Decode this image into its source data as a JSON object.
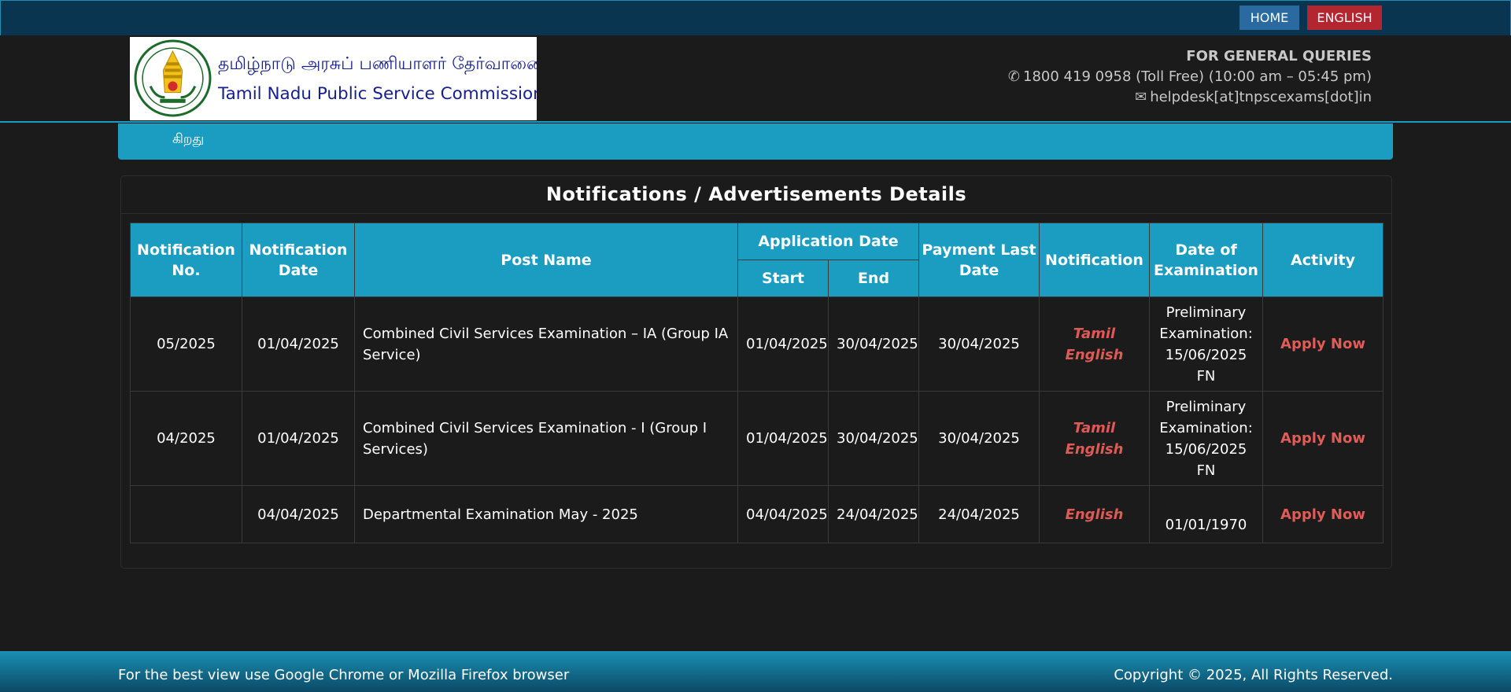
{
  "topbar": {
    "home_label": "HOME",
    "english_label": "ENGLISH"
  },
  "logo": {
    "tamil_name": "தமிழ்நாடு அரசுப் பணியாளர் தேர்வாணையம்",
    "english_name": "Tamil Nadu Public Service Commission"
  },
  "contact": {
    "heading": "FOR GENERAL QUERIES",
    "phone": "1800 419 0958 (Toll Free) (10:00 am – 05:45 pm)",
    "email": "helpdesk[at]tnpscexams[dot]in"
  },
  "nav": {
    "item": "கிறது"
  },
  "panel": {
    "title": "Notifications / Advertisements Details"
  },
  "table": {
    "headers": {
      "notification_no": "Notification No.",
      "notification_date": "Notification Date",
      "post_name": "Post Name",
      "application_date": "Application Date",
      "start": "Start",
      "end": "End",
      "payment_last_date": "Payment Last Date",
      "notification": "Notification",
      "date_of_examination": "Date of Examination",
      "activity": "Activity"
    },
    "rows": [
      {
        "no": "05/2025",
        "date": "01/04/2025",
        "post": "Combined Civil Services Examination – IA (Group IA Service)",
        "start": "01/04/2025",
        "end": "30/04/2025",
        "payment": "30/04/2025",
        "lang1": "Tamil",
        "lang2": "English",
        "exam": "Preliminary Examination: 15/06/2025 FN",
        "action": "Apply Now"
      },
      {
        "no": "04/2025",
        "date": "01/04/2025",
        "post": "Combined Civil Services Examination - I (Group I Services)",
        "start": "01/04/2025",
        "end": "30/04/2025",
        "payment": "30/04/2025",
        "lang1": "Tamil",
        "lang2": "English",
        "exam": "Preliminary Examination: 15/06/2025 FN",
        "action": "Apply Now"
      },
      {
        "no": "",
        "date": "04/04/2025",
        "post": "Departmental Examination May - 2025",
        "start": "04/04/2025",
        "end": "24/04/2025",
        "payment": "24/04/2025",
        "lang1": "English",
        "exam": "01/01/1970",
        "action": "Apply Now"
      }
    ]
  },
  "footer": {
    "left": "For the best view use Google Chrome or Mozilla Firefox browser",
    "right": "Copyright © 2025, All Rights Reserved."
  },
  "colors": {
    "background": "#1b1b1b",
    "accent": "#1a9dc1",
    "topbar": "#0a3550",
    "home_button": "#2a6aa0",
    "english_button": "#b3262f",
    "link_red": "#e15b57"
  },
  "icons": {
    "phone": "phone-icon",
    "email": "envelope-icon",
    "emblem": "tn-emblem-icon"
  }
}
